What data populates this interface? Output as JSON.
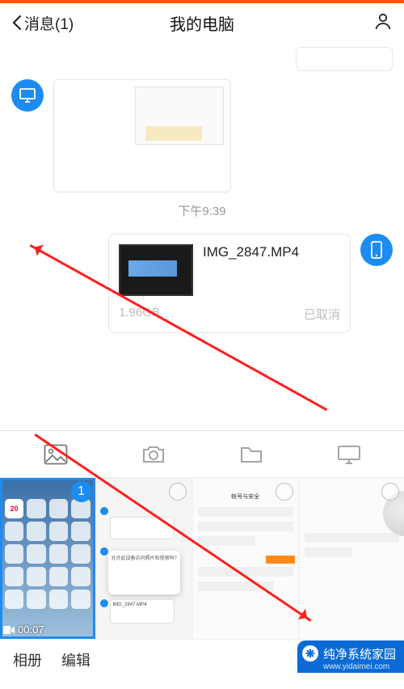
{
  "header": {
    "back_label": "消息(1)",
    "title": "我的电脑"
  },
  "chat": {
    "timestamp": "下午9:39",
    "file": {
      "name": "IMG_2847.MP4",
      "size": "1.96GB",
      "status": "已取消"
    }
  },
  "actionbar": {
    "tabs": [
      "image",
      "camera",
      "file",
      "monitor"
    ]
  },
  "gallery": {
    "items": [
      {
        "type": "video",
        "duration": "00:07",
        "selected": true,
        "selected_index": "1",
        "calendar_day": "20"
      },
      {
        "type": "image",
        "selected": false,
        "popup_text": "允许此设备访问照片和视频吗?",
        "file_label": "IMG_2847.MP4"
      },
      {
        "type": "image",
        "selected": false,
        "heading": "帐号与安全"
      },
      {
        "type": "image",
        "selected": false
      }
    ]
  },
  "bottom": {
    "album": "相册",
    "edit": "编辑"
  },
  "watermark": {
    "title": "纯净系统家园",
    "url": "www.yidaimei.com"
  }
}
